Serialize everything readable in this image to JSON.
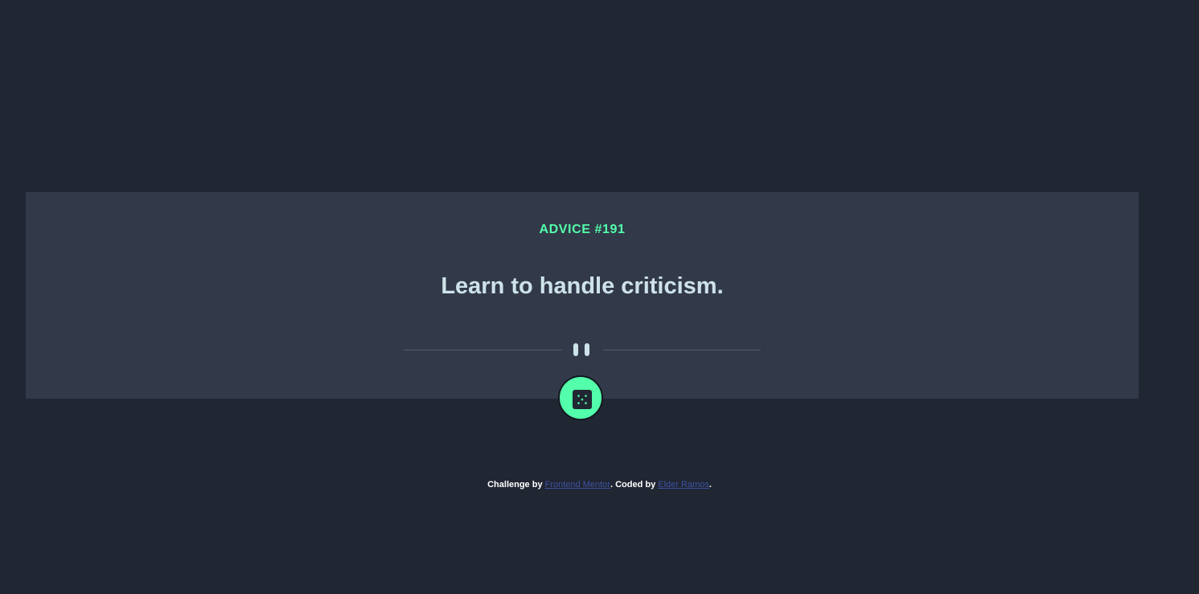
{
  "advice": {
    "label": "ADVICE #191",
    "text": "Learn to handle criticism."
  },
  "dice_button": {
    "icon": "dice-icon"
  },
  "divider": {
    "icon": "pause-icon"
  },
  "attribution": {
    "prefix": "Challenge by ",
    "link1": "Frontend Mentor",
    "middle": ". Coded by ",
    "link2": "Elder Ramos",
    "suffix": "."
  },
  "colors": {
    "background": "#202632",
    "card": "#323a49",
    "accent": "#53ffaa",
    "quote_text": "#cee3e9",
    "link": "#3e52a3"
  }
}
